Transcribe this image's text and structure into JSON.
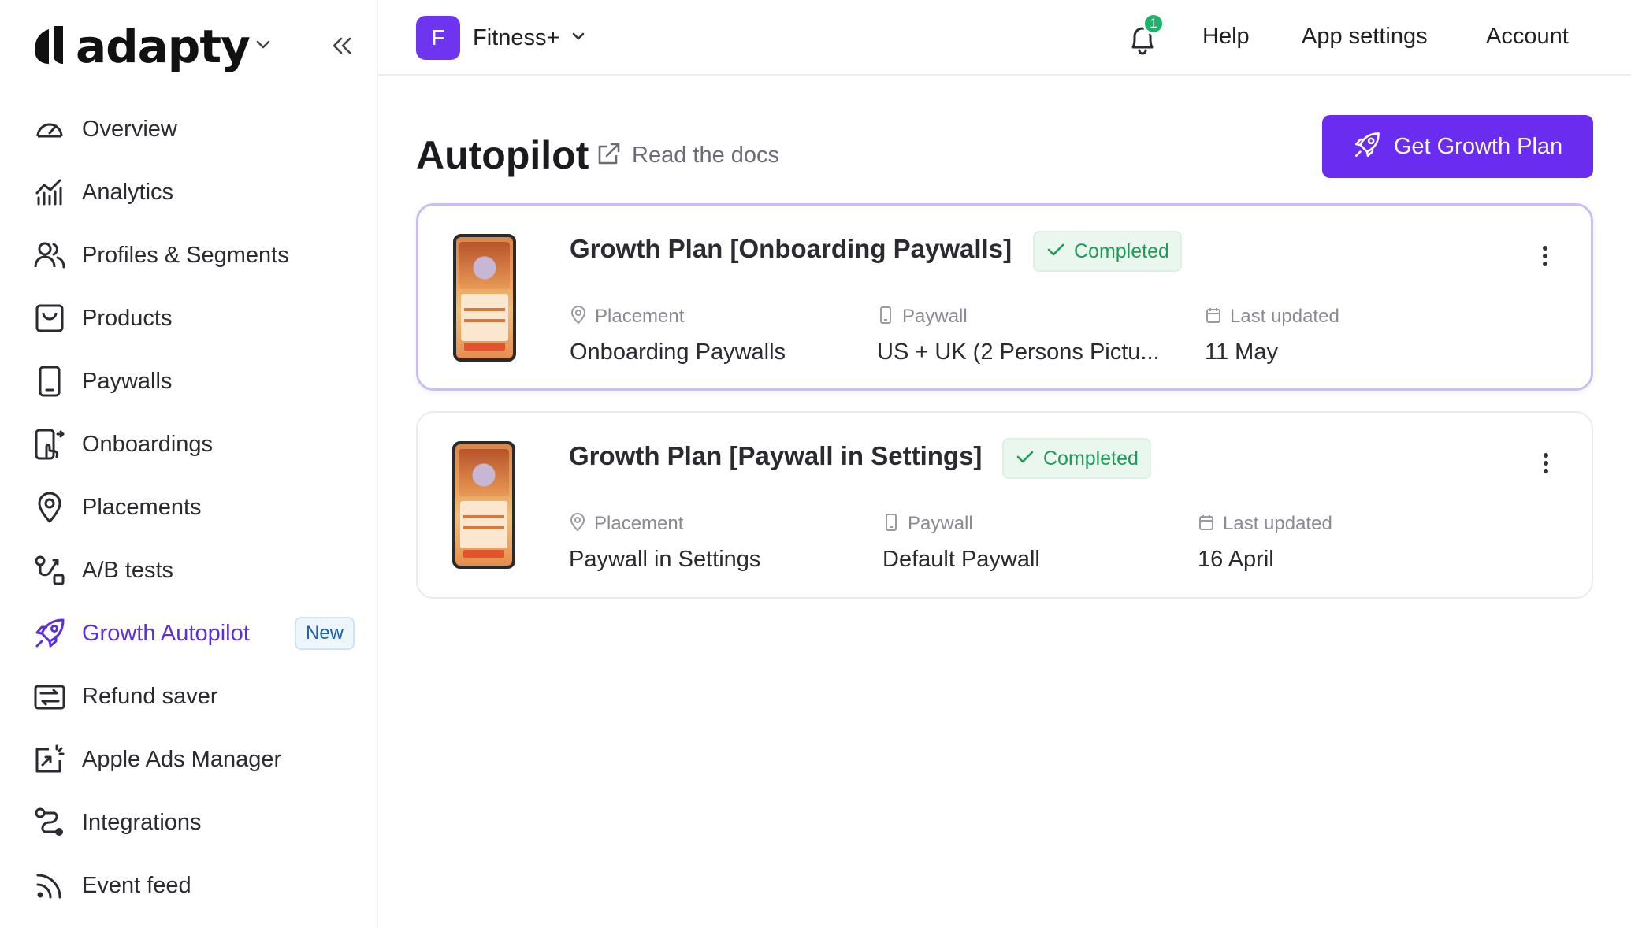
{
  "brand": {
    "name": "adapty"
  },
  "sidebar": {
    "items": [
      {
        "label": "Overview"
      },
      {
        "label": "Analytics"
      },
      {
        "label": "Profiles & Segments"
      },
      {
        "label": "Products"
      },
      {
        "label": "Paywalls"
      },
      {
        "label": "Onboardings"
      },
      {
        "label": "Placements"
      },
      {
        "label": "A/B tests"
      },
      {
        "label": "Growth Autopilot",
        "badge": "New",
        "active": true
      },
      {
        "label": "Refund saver"
      },
      {
        "label": "Apple Ads Manager"
      },
      {
        "label": "Integrations"
      },
      {
        "label": "Event feed"
      }
    ]
  },
  "topbar": {
    "app_initial": "F",
    "app_name": "Fitness+",
    "notifications_count": "1",
    "help": "Help",
    "app_settings": "App settings",
    "account": "Account"
  },
  "page": {
    "title": "Autopilot",
    "docs_link": "Read the docs",
    "primary_button": "Get Growth Plan"
  },
  "meta_labels": {
    "placement": "Placement",
    "paywall": "Paywall",
    "last_updated": "Last updated"
  },
  "plans": [
    {
      "title": "Growth Plan [Onboarding Paywalls]",
      "status": "Completed",
      "placement": "Onboarding Paywalls",
      "paywall": "US + UK (2 Persons Pictu...",
      "last_updated": "11 May"
    },
    {
      "title": "Growth Plan [Paywall in Settings]",
      "status": "Completed",
      "placement": "Paywall in Settings",
      "paywall": "Default Paywall",
      "last_updated": "16 April"
    }
  ],
  "colors": {
    "accent": "#6a2df0",
    "active_nav": "#5b2ee0",
    "success": "#1f9a58",
    "badge_bg": "#eef6fd"
  }
}
